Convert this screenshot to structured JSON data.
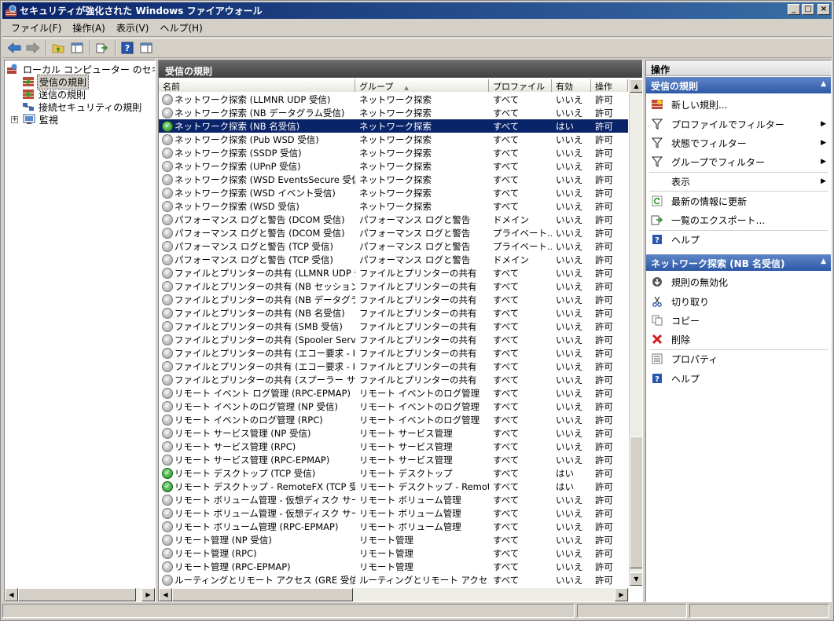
{
  "window": {
    "title": "セキュリティが強化された Windows ファイアウォール"
  },
  "menu": [
    "ファイル(F)",
    "操作(A)",
    "表示(V)",
    "ヘルプ(H)"
  ],
  "tree": {
    "root": "ローカル コンピューター のセキュリティ",
    "inbound": "受信の規則",
    "outbound": "送信の規則",
    "connection": "接続セキュリティの規則",
    "monitor": "監視"
  },
  "middle": {
    "header": "受信の規則",
    "columns": [
      "名前",
      "グループ",
      "プロファイル",
      "有効",
      "操作"
    ],
    "rows": [
      {
        "name": "ネットワーク探索 (LLMNR UDP 受信)",
        "group": "ネットワーク探索",
        "profile": "すべて",
        "enabled": "いいえ",
        "action": "許可",
        "on": false
      },
      {
        "name": "ネットワーク探索 (NB データグラム受信)",
        "group": "ネットワーク探索",
        "profile": "すべて",
        "enabled": "いいえ",
        "action": "許可",
        "on": false
      },
      {
        "name": "ネットワーク探索 (NB 名受信)",
        "group": "ネットワーク探索",
        "profile": "すべて",
        "enabled": "はい",
        "action": "許可",
        "on": true,
        "selected": true
      },
      {
        "name": "ネットワーク探索 (Pub WSD 受信)",
        "group": "ネットワーク探索",
        "profile": "すべて",
        "enabled": "いいえ",
        "action": "許可",
        "on": false
      },
      {
        "name": "ネットワーク探索 (SSDP 受信)",
        "group": "ネットワーク探索",
        "profile": "すべて",
        "enabled": "いいえ",
        "action": "許可",
        "on": false
      },
      {
        "name": "ネットワーク探索 (UPnP 受信)",
        "group": "ネットワーク探索",
        "profile": "すべて",
        "enabled": "いいえ",
        "action": "許可",
        "on": false
      },
      {
        "name": "ネットワーク探索 (WSD EventsSecure 受信)",
        "group": "ネットワーク探索",
        "profile": "すべて",
        "enabled": "いいえ",
        "action": "許可",
        "on": false
      },
      {
        "name": "ネットワーク探索 (WSD イベント受信)",
        "group": "ネットワーク探索",
        "profile": "すべて",
        "enabled": "いいえ",
        "action": "許可",
        "on": false
      },
      {
        "name": "ネットワーク探索 (WSD 受信)",
        "group": "ネットワーク探索",
        "profile": "すべて",
        "enabled": "いいえ",
        "action": "許可",
        "on": false
      },
      {
        "name": "パフォーマンス ログと警告 (DCOM 受信)",
        "group": "パフォーマンス ログと警告",
        "profile": "ドメイン",
        "enabled": "いいえ",
        "action": "許可",
        "on": false
      },
      {
        "name": "パフォーマンス ログと警告 (DCOM 受信)",
        "group": "パフォーマンス ログと警告",
        "profile": "プライベート…",
        "enabled": "いいえ",
        "action": "許可",
        "on": false
      },
      {
        "name": "パフォーマンス ログと警告 (TCP 受信)",
        "group": "パフォーマンス ログと警告",
        "profile": "プライベート…",
        "enabled": "いいえ",
        "action": "許可",
        "on": false
      },
      {
        "name": "パフォーマンス ログと警告 (TCP 受信)",
        "group": "パフォーマンス ログと警告",
        "profile": "ドメイン",
        "enabled": "いいえ",
        "action": "許可",
        "on": false
      },
      {
        "name": "ファイルとプリンターの共有 (LLMNR UDP 受信)",
        "group": "ファイルとプリンターの共有",
        "profile": "すべて",
        "enabled": "いいえ",
        "action": "許可",
        "on": false
      },
      {
        "name": "ファイルとプリンターの共有 (NB セッション受信)",
        "group": "ファイルとプリンターの共有",
        "profile": "すべて",
        "enabled": "いいえ",
        "action": "許可",
        "on": false
      },
      {
        "name": "ファイルとプリンターの共有 (NB データグラム受…",
        "group": "ファイルとプリンターの共有",
        "profile": "すべて",
        "enabled": "いいえ",
        "action": "許可",
        "on": false
      },
      {
        "name": "ファイルとプリンターの共有 (NB 名受信)",
        "group": "ファイルとプリンターの共有",
        "profile": "すべて",
        "enabled": "いいえ",
        "action": "許可",
        "on": false
      },
      {
        "name": "ファイルとプリンターの共有 (SMB 受信)",
        "group": "ファイルとプリンターの共有",
        "profile": "すべて",
        "enabled": "いいえ",
        "action": "許可",
        "on": false
      },
      {
        "name": "ファイルとプリンターの共有 (Spooler Service -…",
        "group": "ファイルとプリンターの共有",
        "profile": "すべて",
        "enabled": "いいえ",
        "action": "許可",
        "on": false
      },
      {
        "name": "ファイルとプリンターの共有 (エコー要求 - ICMP…",
        "group": "ファイルとプリンターの共有",
        "profile": "すべて",
        "enabled": "いいえ",
        "action": "許可",
        "on": false
      },
      {
        "name": "ファイルとプリンターの共有 (エコー要求 - ICMP…",
        "group": "ファイルとプリンターの共有",
        "profile": "すべて",
        "enabled": "いいえ",
        "action": "許可",
        "on": false
      },
      {
        "name": "ファイルとプリンターの共有 (スプーラー サービス…",
        "group": "ファイルとプリンターの共有",
        "profile": "すべて",
        "enabled": "いいえ",
        "action": "許可",
        "on": false
      },
      {
        "name": "リモート イベント ログ管理 (RPC-EPMAP)",
        "group": "リモート イベントのログ管理",
        "profile": "すべて",
        "enabled": "いいえ",
        "action": "許可",
        "on": false
      },
      {
        "name": "リモート イベントのログ管理 (NP 受信)",
        "group": "リモート イベントのログ管理",
        "profile": "すべて",
        "enabled": "いいえ",
        "action": "許可",
        "on": false
      },
      {
        "name": "リモート イベントのログ管理 (RPC)",
        "group": "リモート イベントのログ管理",
        "profile": "すべて",
        "enabled": "いいえ",
        "action": "許可",
        "on": false
      },
      {
        "name": "リモート サービス管理 (NP 受信)",
        "group": "リモート サービス管理",
        "profile": "すべて",
        "enabled": "いいえ",
        "action": "許可",
        "on": false
      },
      {
        "name": "リモート サービス管理 (RPC)",
        "group": "リモート サービス管理",
        "profile": "すべて",
        "enabled": "いいえ",
        "action": "許可",
        "on": false
      },
      {
        "name": "リモート サービス管理 (RPC-EPMAP)",
        "group": "リモート サービス管理",
        "profile": "すべて",
        "enabled": "いいえ",
        "action": "許可",
        "on": false
      },
      {
        "name": "リモート デスクトップ (TCP 受信)",
        "group": "リモート デスクトップ",
        "profile": "すべて",
        "enabled": "はい",
        "action": "許可",
        "on": true
      },
      {
        "name": "リモート デスクトップ - RemoteFX (TCP 受信)",
        "group": "リモート デスクトップ - RemoteFX",
        "profile": "すべて",
        "enabled": "はい",
        "action": "許可",
        "on": true
      },
      {
        "name": "リモート ボリューム管理 - 仮想ディスク サービス…",
        "group": "リモート ボリューム管理",
        "profile": "すべて",
        "enabled": "いいえ",
        "action": "許可",
        "on": false
      },
      {
        "name": "リモート ボリューム管理 - 仮想ディスク サービス…",
        "group": "リモート ボリューム管理",
        "profile": "すべて",
        "enabled": "いいえ",
        "action": "許可",
        "on": false
      },
      {
        "name": "リモート ボリューム管理 (RPC-EPMAP)",
        "group": "リモート ボリューム管理",
        "profile": "すべて",
        "enabled": "いいえ",
        "action": "許可",
        "on": false
      },
      {
        "name": "リモート管理 (NP 受信)",
        "group": "リモート管理",
        "profile": "すべて",
        "enabled": "いいえ",
        "action": "許可",
        "on": false
      },
      {
        "name": "リモート管理 (RPC)",
        "group": "リモート管理",
        "profile": "すべて",
        "enabled": "いいえ",
        "action": "許可",
        "on": false
      },
      {
        "name": "リモート管理 (RPC-EPMAP)",
        "group": "リモート管理",
        "profile": "すべて",
        "enabled": "いいえ",
        "action": "許可",
        "on": false
      },
      {
        "name": "ルーティングとリモート アクセス (GRE 受信)",
        "group": "ルーティングとリモート アクセス",
        "profile": "すべて",
        "enabled": "いいえ",
        "action": "許可",
        "on": false
      }
    ]
  },
  "actions": {
    "header": "操作",
    "section1": "受信の規則",
    "section1_items": [
      "新しい規則...",
      "プロファイルでフィルター",
      "状態でフィルター",
      "グループでフィルター",
      "表示",
      "最新の情報に更新",
      "一覧のエクスポート...",
      "ヘルプ"
    ],
    "section2": "ネットワーク探索 (NB 名受信)",
    "section2_items": [
      "規則の無効化",
      "切り取り",
      "コピー",
      "削除",
      "プロパティ",
      "ヘルプ"
    ]
  },
  "colors": {
    "title_start": "#0a246a",
    "title_end": "#3a6ea5",
    "selection": "#0a246a",
    "section_header": "#2d58a6"
  }
}
